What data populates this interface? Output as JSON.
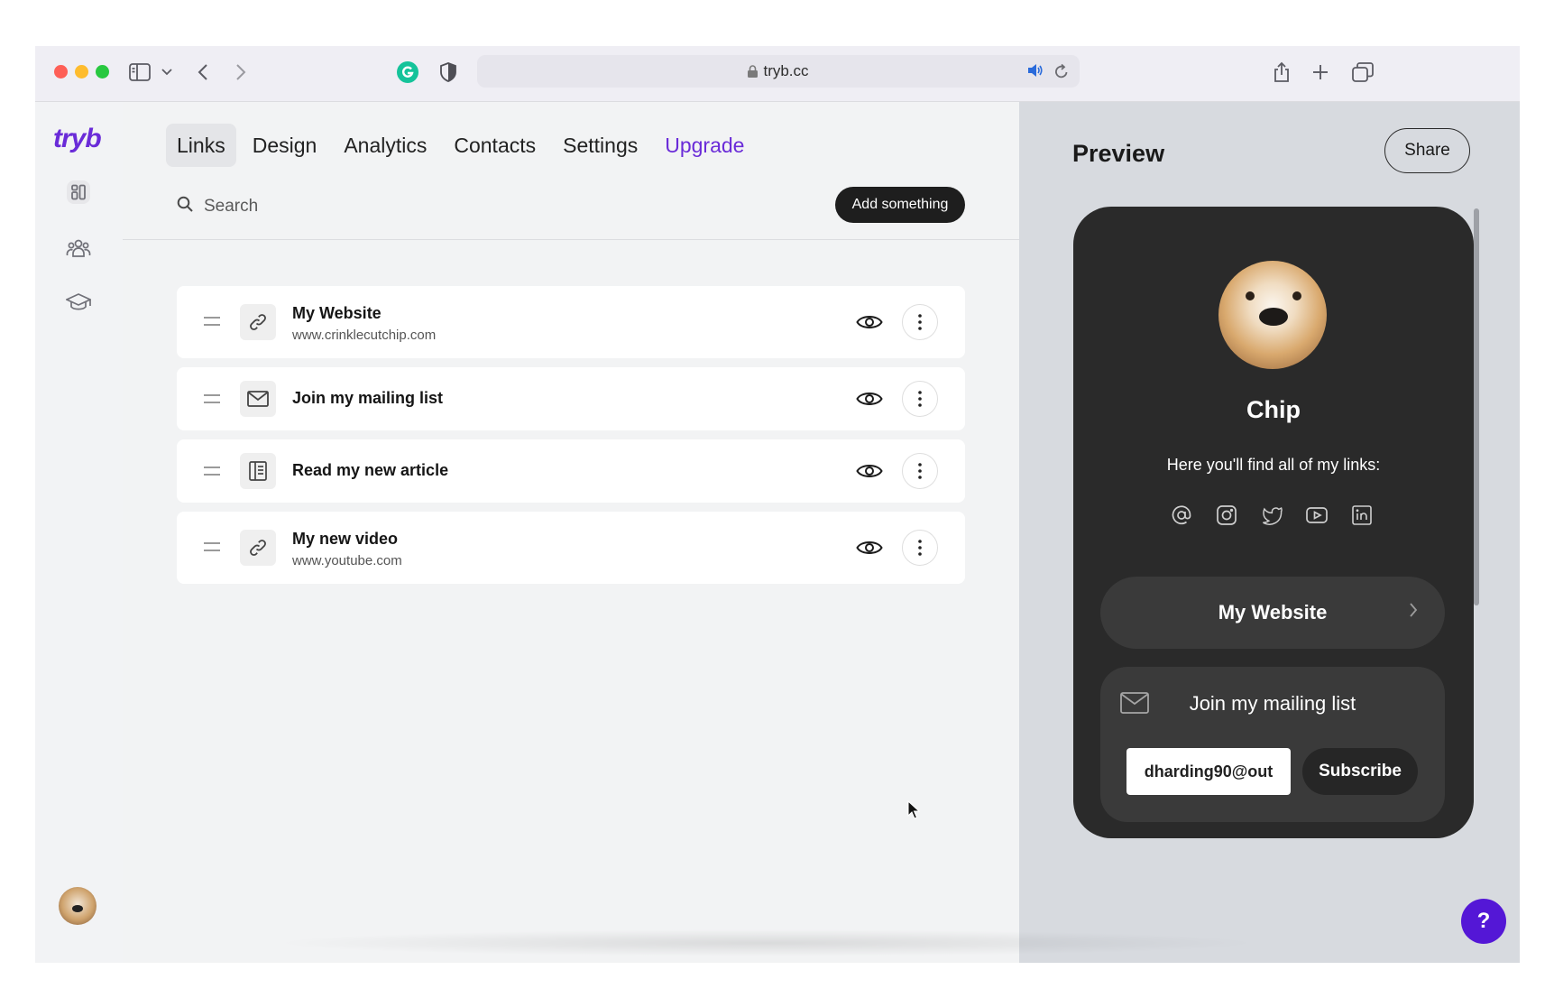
{
  "browser": {
    "url": "tryb.cc"
  },
  "app": {
    "logo": "tryb"
  },
  "tabs": [
    {
      "label": "Links"
    },
    {
      "label": "Design"
    },
    {
      "label": "Analytics"
    },
    {
      "label": "Contacts"
    },
    {
      "label": "Settings"
    },
    {
      "label": "Upgrade"
    }
  ],
  "editor": {
    "search_placeholder": "Search",
    "add_label": "Add something"
  },
  "links": [
    {
      "title": "My Website",
      "url": "www.crinklecutchip.com",
      "icon": "link-icon"
    },
    {
      "title": "Join my mailing list",
      "url": "",
      "icon": "envelope-icon"
    },
    {
      "title": "Read my new article",
      "url": "",
      "icon": "article-icon"
    },
    {
      "title": "My new video",
      "url": "www.youtube.com",
      "icon": "link-icon"
    }
  ],
  "preview": {
    "title": "Preview",
    "share_label": "Share",
    "profile_name": "Chip",
    "bio": "Here you'll find all of my links:",
    "socials": [
      "email-icon",
      "instagram-icon",
      "twitter-icon",
      "youtube-icon",
      "linkedin-icon"
    ],
    "link_button": "My Website",
    "mailing_title": "Join my mailing list",
    "email_value": "dharding90@out",
    "subscribe_label": "Subscribe"
  },
  "help": {
    "label": "?"
  },
  "colors": {
    "accent": "#6a2bd8",
    "help_button": "#5417d6",
    "phone_bg": "#2a2a2a"
  }
}
